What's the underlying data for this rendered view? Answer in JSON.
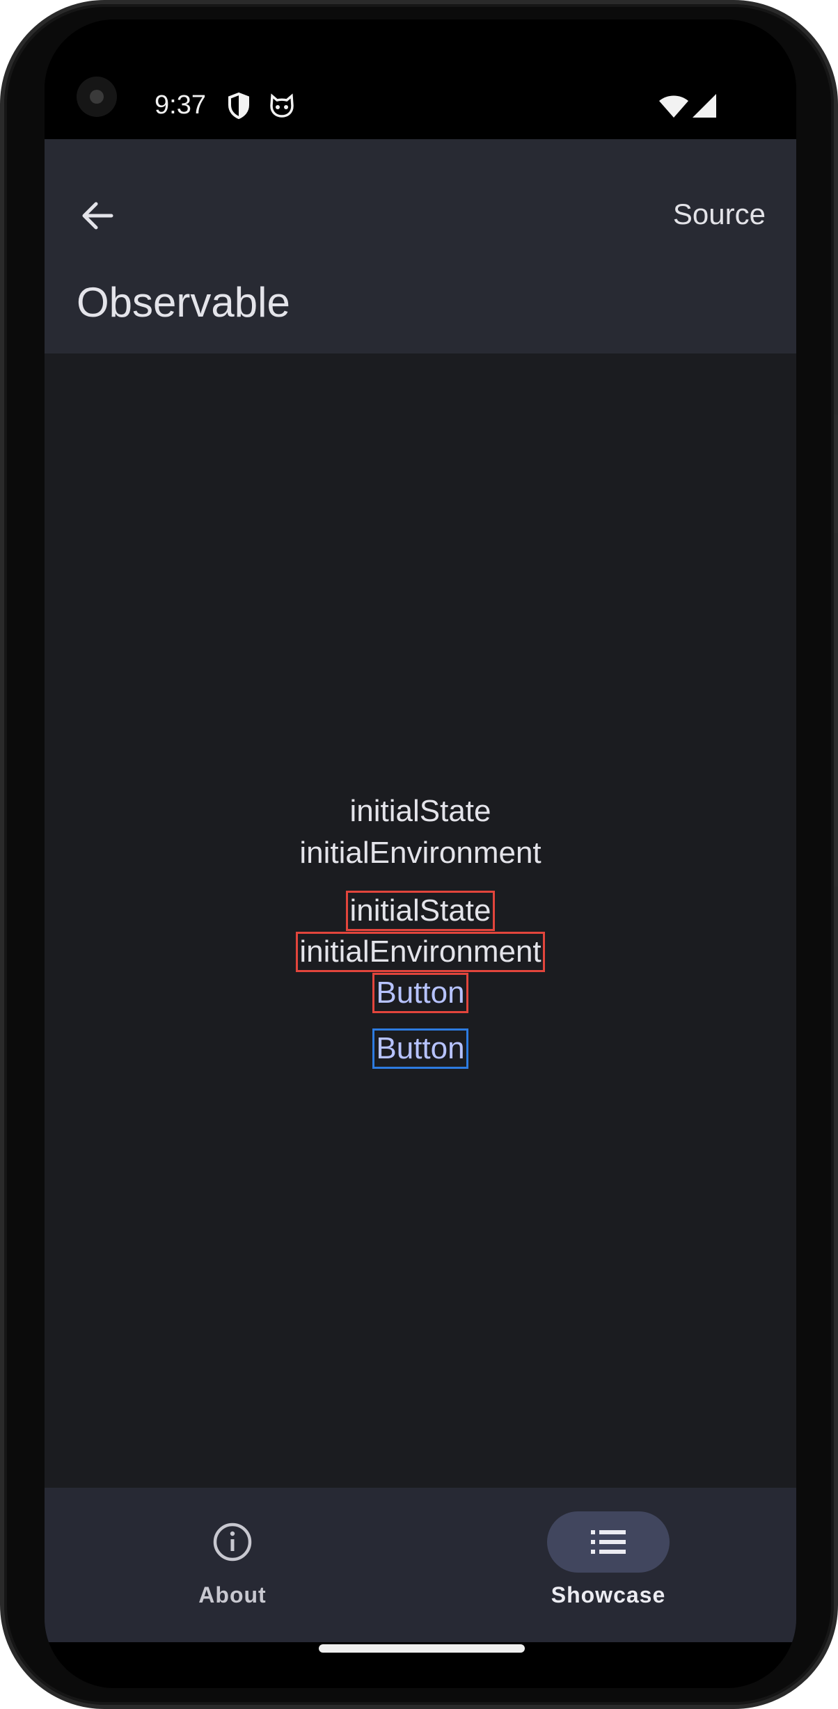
{
  "status_bar": {
    "time": "9:37",
    "icons": [
      "shield-icon",
      "cat-face-icon",
      "wifi-icon",
      "signal-icon"
    ]
  },
  "app_bar": {
    "back_icon": "arrow-left-icon",
    "source_label": "Source",
    "title": "Observable"
  },
  "content": {
    "plain_state": "initialState",
    "plain_environment": "initialEnvironment",
    "highlighted_state": "initialState",
    "highlighted_environment": "initialEnvironment",
    "red_button_label": "Button",
    "blue_button_label": "Button"
  },
  "bottom_nav": {
    "items": [
      {
        "label": "About",
        "icon": "info-icon",
        "active": false
      },
      {
        "label": "Showcase",
        "icon": "list-icon",
        "active": true
      }
    ]
  },
  "colors": {
    "top_bar": "#282a33",
    "background": "#1b1c20",
    "highlight_red": "#e2453c",
    "highlight_blue": "#2d7be0",
    "button_text": "#b7c3ff",
    "nav_active_pill": "#41465e"
  }
}
